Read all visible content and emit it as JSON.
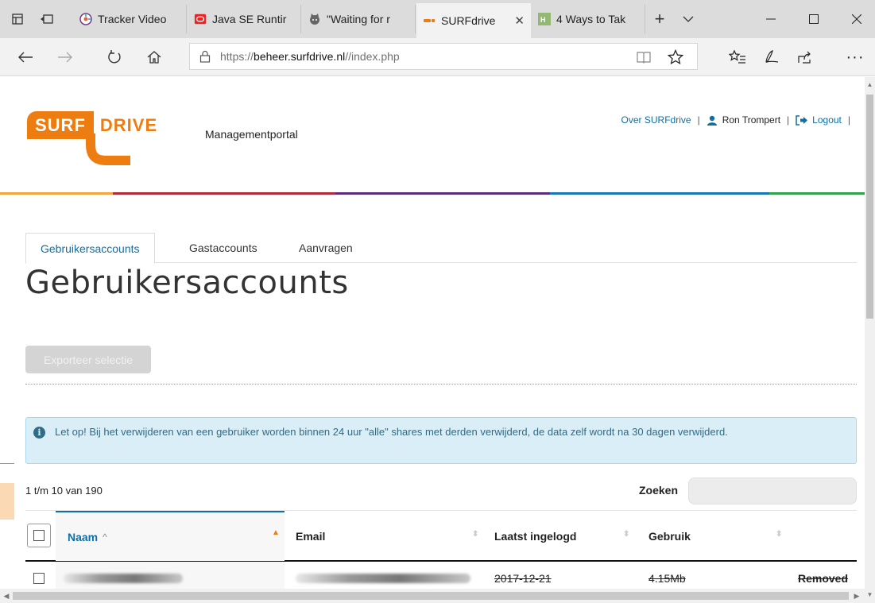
{
  "browser": {
    "tabs": [
      {
        "title": "Tracker Video",
        "icon": "tracker-icon"
      },
      {
        "title": "Java SE Runtir",
        "icon": "oracle-icon"
      },
      {
        "title": "\"Waiting for r",
        "icon": "github-cat-icon"
      },
      {
        "title": "SURFdrive",
        "icon": "surfdrive-icon",
        "active": true
      },
      {
        "title": "4 Ways to Tak",
        "icon": "wikihow-icon"
      }
    ],
    "url": {
      "prefix": "https://",
      "host": "beheer.surfdrive.nl",
      "path": "//index.php"
    }
  },
  "header": {
    "logo_surf": "SURF",
    "logo_drive": "DRIVE",
    "portal_title": "Managementportal",
    "links": {
      "about": "Over SURFdrive",
      "user": "Ron Trompert",
      "logout": "Logout",
      "separator": "|"
    }
  },
  "colors": {
    "brand_orange": "#ee7d11",
    "link_blue": "#0d6fa5",
    "bar": [
      "#f3a73a",
      "#b22b3a",
      "#5a2e7a",
      "#1878b5",
      "#33a04b"
    ]
  },
  "tabs": [
    {
      "label": "Gebruikersaccounts",
      "active": true
    },
    {
      "label": "Gastaccounts"
    },
    {
      "label": "Aanvragen"
    }
  ],
  "page_title": "Gebruikersaccounts",
  "export_button": "Exporteer selectie",
  "alert": {
    "icon": "info-icon",
    "text": "Let op! Bij het verwijderen van een gebruiker worden binnen 24 uur \"alle\" shares met derden verwijderd, de data zelf wordt na 30 dagen verwijderd."
  },
  "count_text": "1 t/m 10 van 190",
  "search": {
    "label": "Zoeken",
    "value": ""
  },
  "table": {
    "columns": [
      "Naam",
      "Email",
      "Laatst ingelogd",
      "Gebruik"
    ],
    "sort_indicator": "^",
    "rows": [
      {
        "last_login": "2017-12-21",
        "usage": "4.15Mb",
        "status": "Removed"
      }
    ]
  }
}
